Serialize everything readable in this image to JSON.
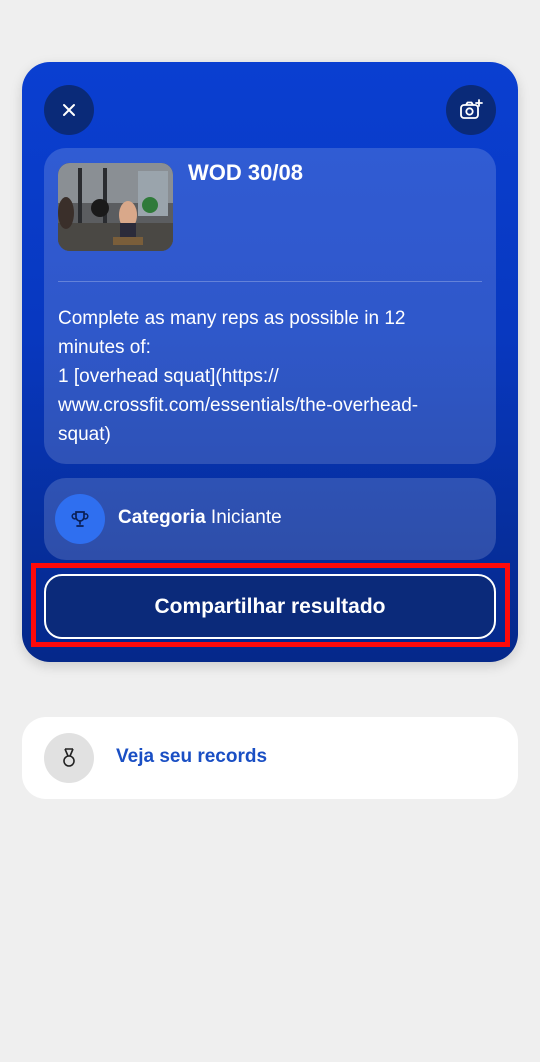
{
  "workout_card": {
    "close_icon": "close-icon",
    "camera_icon": "camera-add-icon",
    "wod": {
      "title": "WOD 30/08",
      "thumbnail": "crossfit-gym-photo",
      "description": "Complete as many reps as possible in 12\nminutes of:\n1 [overhead squat](https://\nwww.crossfit.com/essentials/the-overhead-\nsquat)"
    },
    "category": {
      "icon": "trophy-icon",
      "label": "Categoria",
      "value": "Iniciante"
    },
    "share_button_label": "Compartilhar resultado"
  },
  "records": {
    "icon": "medal-icon",
    "label": "Veja seu records"
  },
  "colors": {
    "card_blue": "#0838c0",
    "button_navy": "#0b2a7a",
    "highlight_red": "#ff0a0a",
    "link_blue": "#1a4fc4"
  }
}
